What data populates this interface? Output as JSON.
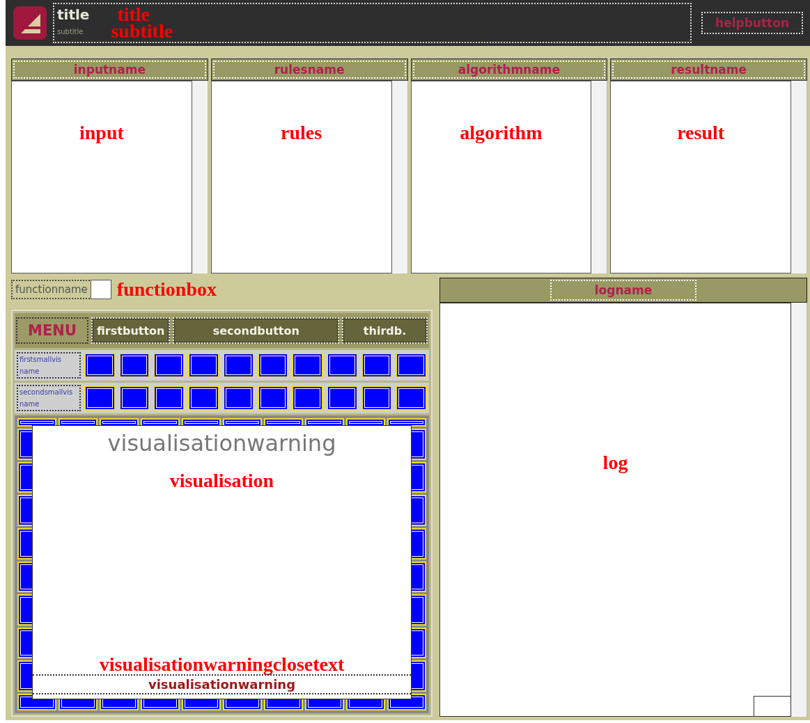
{
  "header": {
    "title": "title",
    "subtitle": "subtitle",
    "annotations": [
      "title",
      "subtitle"
    ],
    "help_button": "helpbutton"
  },
  "panels": [
    {
      "name": "inputname",
      "content": "input"
    },
    {
      "name": "rulesname",
      "content": "rules"
    },
    {
      "name": "algorithmname",
      "content": "algorithm"
    },
    {
      "name": "resultname",
      "content": "result"
    }
  ],
  "function": {
    "label": "functionname",
    "annotation": "functionbox"
  },
  "menu": {
    "label": "MENU",
    "buttons": [
      "firstbutton",
      "secondbutton",
      "thirdb."
    ]
  },
  "small_vis": [
    {
      "name": "firstsmallvis name"
    },
    {
      "name": "secondsmallvis name"
    }
  ],
  "visualisation": {
    "warning_title": "visualisationwarning",
    "annotation": "visualisation",
    "close_annotation": "visualisationwarningclosetext",
    "close_text": "visualisationwarning"
  },
  "log": {
    "name": "logname",
    "content": "log"
  }
}
